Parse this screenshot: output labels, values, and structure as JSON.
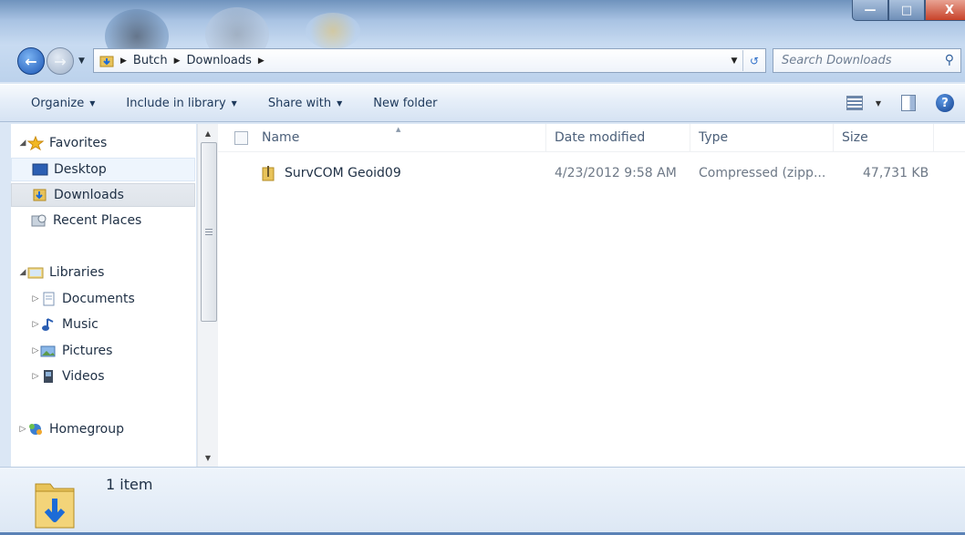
{
  "window": {
    "controls": {
      "minimize": "—",
      "maximize": "□",
      "close": "X"
    }
  },
  "address": {
    "crumbs": [
      "Butch",
      "Downloads"
    ],
    "search_placeholder": "Search Downloads"
  },
  "toolbar": {
    "organize": "Organize",
    "include": "Include in library",
    "share": "Share with",
    "new_folder": "New folder"
  },
  "nav": {
    "favorites": "Favorites",
    "desktop": "Desktop",
    "downloads": "Downloads",
    "recent": "Recent Places",
    "libraries": "Libraries",
    "documents": "Documents",
    "music": "Music",
    "pictures": "Pictures",
    "videos": "Videos",
    "homegroup": "Homegroup"
  },
  "columns": {
    "name": "Name",
    "date": "Date modified",
    "type": "Type",
    "size": "Size"
  },
  "files": [
    {
      "name": "SurvCOM Geoid09",
      "date": "4/23/2012 9:58 AM",
      "type": "Compressed (zipp...",
      "size": "47,731 KB"
    }
  ],
  "status": {
    "count": "1 item"
  },
  "colors": {
    "accent": "#1c56b4",
    "folder": "#e8c35a"
  }
}
